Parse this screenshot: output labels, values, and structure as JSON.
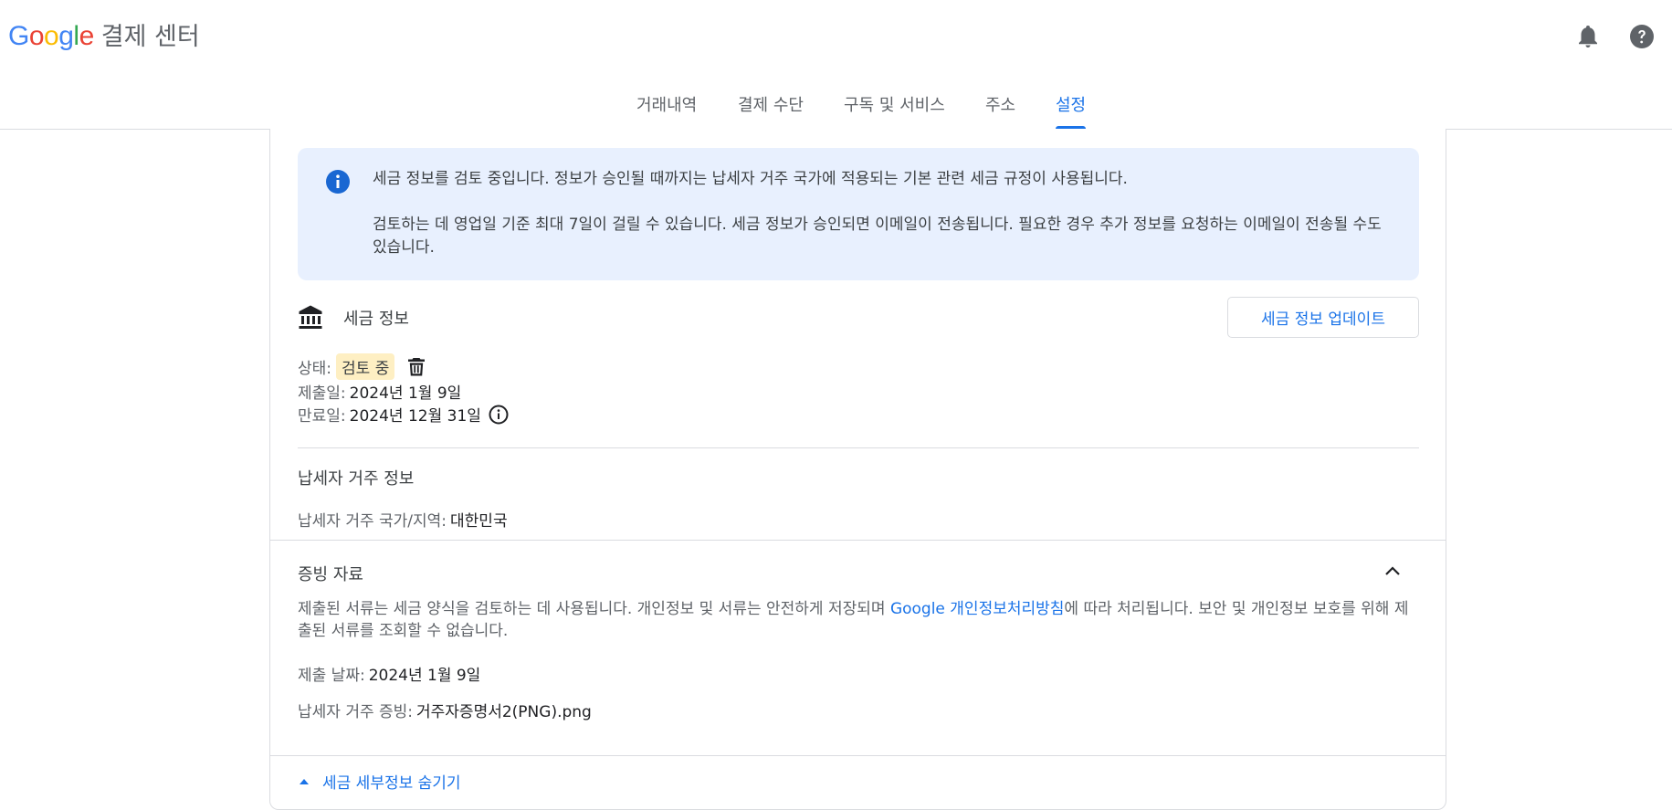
{
  "header": {
    "logo_letters": [
      "G",
      "o",
      "o",
      "g",
      "l",
      "e"
    ],
    "product_name": "결제 센터",
    "notifications_icon": "bell-icon",
    "help_icon": "help-icon"
  },
  "tabs": [
    {
      "label": "거래내역",
      "active": false
    },
    {
      "label": "결제 수단",
      "active": false
    },
    {
      "label": "구독 및 서비스",
      "active": false
    },
    {
      "label": "주소",
      "active": false
    },
    {
      "label": "설정",
      "active": true
    }
  ],
  "banner": {
    "icon": "info-icon",
    "line1": "세금 정보를 검토 중입니다. 정보가 승인될 때까지는 납세자 거주 국가에 적용되는 기본 관련 세금 규정이 사용됩니다.",
    "line2": "검토하는 데 영업일 기준 최대 7일이 걸릴 수 있습니다. 세금 정보가 승인되면 이메일이 전송됩니다. 필요한 경우 추가 정보를 요청하는 이메일이 전송될 수도 있습니다."
  },
  "tax_info": {
    "icon": "bank-icon",
    "title": "세금 정보",
    "update_button": "세금 정보 업데이트",
    "status_label": "상태:",
    "status_value": "검토 중",
    "submitted_label": "제출일:",
    "submitted_value": "2024년 1월 9일",
    "expiry_label": "만료일:",
    "expiry_value": "2024년 12월 31일"
  },
  "residency": {
    "title": "납세자 거주 정보",
    "country_label": "납세자 거주 국가/지역:",
    "country_value": "대한민국"
  },
  "evidence": {
    "title": "증빙 자료",
    "desc_before": "제출된 서류는 세금 양식을 검토하는 데 사용됩니다. 개인정보 및 서류는 안전하게 저장되며 ",
    "policy_link": "Google 개인정보처리방침",
    "desc_after": "에 따라 처리됩니다. 보안 및 개인정보 보호를 위해 제출된 서류를 조회할 수 없습니다.",
    "submit_date_label": "제출 날짜:",
    "submit_date_value": "2024년 1월 9일",
    "proof_label": "납세자 거주 증빙:",
    "proof_value": "거주자증명서2(PNG).png"
  },
  "footer": {
    "hide_details": "세금 세부정보 숨기기"
  },
  "colors": {
    "accent": "#1a73e8",
    "banner_bg": "#e8f0fe",
    "status_bg": "#feefc3",
    "divider": "#dadce0"
  }
}
